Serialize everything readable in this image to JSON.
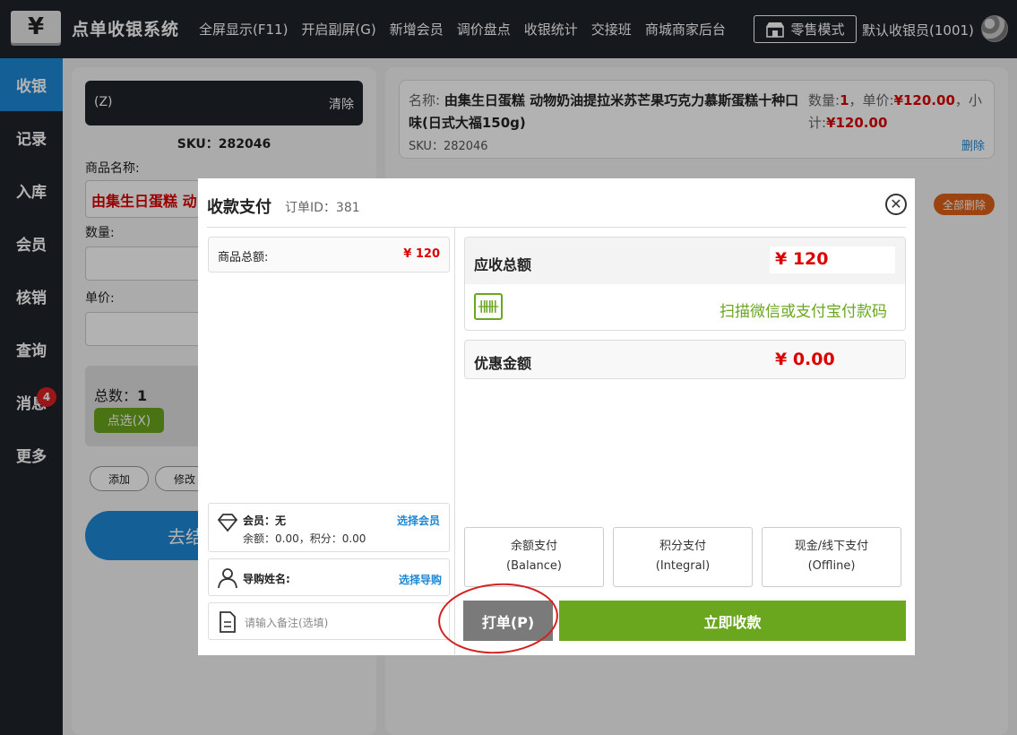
{
  "header": {
    "logo_glyph": "¥",
    "title": "点单收银系统",
    "menu": [
      "全屏显示(F11)",
      "开启副屏(G)",
      "新增会员",
      "调价盘点",
      "收银统计",
      "交接班",
      "商城商家后台"
    ],
    "retail_mode": "零售模式",
    "cashier": "默认收银员(1001)"
  },
  "sidebar": {
    "items": [
      {
        "label": "收银",
        "active": true
      },
      {
        "label": "记录"
      },
      {
        "label": "入库"
      },
      {
        "label": "会员"
      },
      {
        "label": "核销"
      },
      {
        "label": "查询"
      },
      {
        "label": "消息",
        "badge": "4"
      },
      {
        "label": "更多"
      }
    ]
  },
  "left_panel": {
    "scan_placeholder": "(Z)",
    "clear_label": "清除",
    "sku": "SKU：282046",
    "product_name_label": "商品名称:",
    "product_name_value": "由集生日蛋糕 动",
    "qty_label": "数量:",
    "price_label": "单价:",
    "total_label": "总数：",
    "total_value": "1",
    "pick_label": "点选(X)",
    "add_label": "添加",
    "edit_label": "修改",
    "checkout_label": "去结"
  },
  "cart": {
    "name_key": "名称:",
    "name_value": "由集生日蛋糕 动物奶油提拉米苏芒果巧克力慕斯蛋糕十种口味(日式大福150g)",
    "qty_key": "数量:",
    "qty_value": "1",
    "price_key": "，单价:",
    "price_value": "¥120.00",
    "subtotal_key": "，小计:",
    "subtotal_value": "¥120.00",
    "sku": "SKU：282046",
    "delete_label": "删除",
    "delete_all_label": "全部删除"
  },
  "modal": {
    "title": "收款支付",
    "order_id": "订单ID：381",
    "close_glyph": "✕",
    "goods_total_label": "商品总额:",
    "goods_total_value": "¥ 120",
    "member_label": "会员：无",
    "member_sub": "余额：0.00，积分：0.00",
    "select_member": "选择会员",
    "guide_label": "导购姓名:",
    "select_guide": "选择导购",
    "remark_placeholder": "请输入备注(选填)",
    "receivable_label": "应收总额",
    "receivable_value": "¥ 120",
    "scan_hint": "扫描微信或支付宝付款码",
    "discount_label": "优惠金额",
    "discount_value": "¥ 0.00",
    "pay_options": [
      {
        "label": "余额支付",
        "sub": "(Balance)"
      },
      {
        "label": "积分支付",
        "sub": "(Integral)"
      },
      {
        "label": "现金/线下支付",
        "sub": "(Offline)"
      }
    ],
    "print_label": "打单(P)",
    "pay_now_label": "立即收款"
  },
  "colors": {
    "dark": "#1f232a",
    "blue": "#1e88d6",
    "green": "#6aa61e",
    "red": "#d00000",
    "orange": "#e0601a"
  }
}
